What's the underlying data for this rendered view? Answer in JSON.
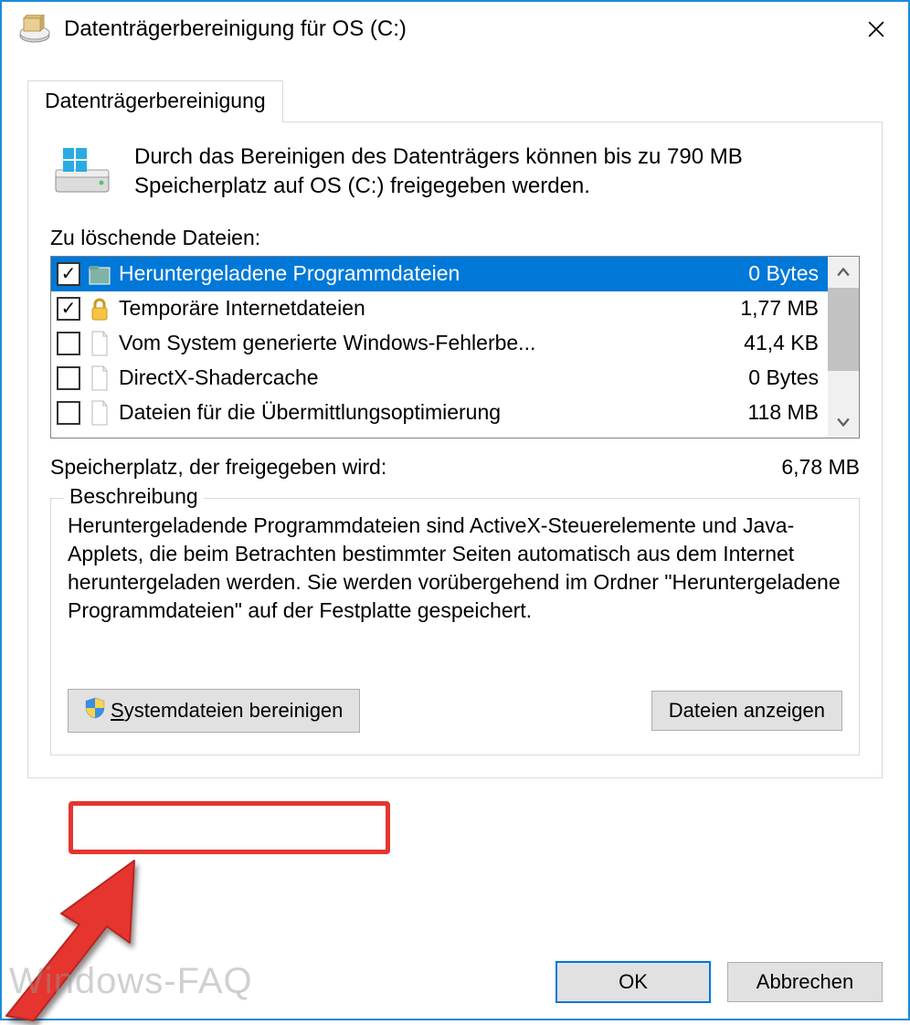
{
  "window": {
    "title": "Datenträgerbereinigung für OS (C:)"
  },
  "tab": {
    "label": "Datenträgerbereinigung"
  },
  "intro": "Durch das Bereinigen des Datenträgers können bis zu 790 MB Speicherplatz auf OS (C:) freigegeben werden.",
  "files_label": "Zu löschende Dateien:",
  "files": [
    {
      "checked": true,
      "icon": "folder",
      "name": "Heruntergeladene Programmdateien",
      "size": "0 Bytes",
      "selected": true
    },
    {
      "checked": true,
      "icon": "lock",
      "name": "Temporäre Internetdateien",
      "size": "1,77 MB",
      "selected": false
    },
    {
      "checked": false,
      "icon": "file",
      "name": "Vom System generierte Windows-Fehlerbe...",
      "size": "41,4 KB",
      "selected": false
    },
    {
      "checked": false,
      "icon": "file",
      "name": "DirectX-Shadercache",
      "size": "0 Bytes",
      "selected": false
    },
    {
      "checked": false,
      "icon": "file",
      "name": "Dateien für die Übermittlungsoptimierung",
      "size": "118 MB",
      "selected": false
    }
  ],
  "space": {
    "label": "Speicherplatz, der freigegeben wird:",
    "value": "6,78 MB"
  },
  "description": {
    "legend": "Beschreibung",
    "text": "Heruntergeladende Programmdateien sind ActiveX-Steuerelemente und Java-Applets, die beim Betrachten bestimmter Seiten automatisch aus dem Internet heruntergeladen werden. Sie werden vorübergehend im Ordner \"Heruntergeladene Programmdateien\" auf der Festplatte gespeichert."
  },
  "buttons": {
    "clean_system_prefix": "S",
    "clean_system_rest": "ystemdateien bereinigen",
    "view_files": "Dateien anzeigen",
    "ok": "OK",
    "cancel": "Abbrechen"
  },
  "watermark": "Windows-FAQ"
}
